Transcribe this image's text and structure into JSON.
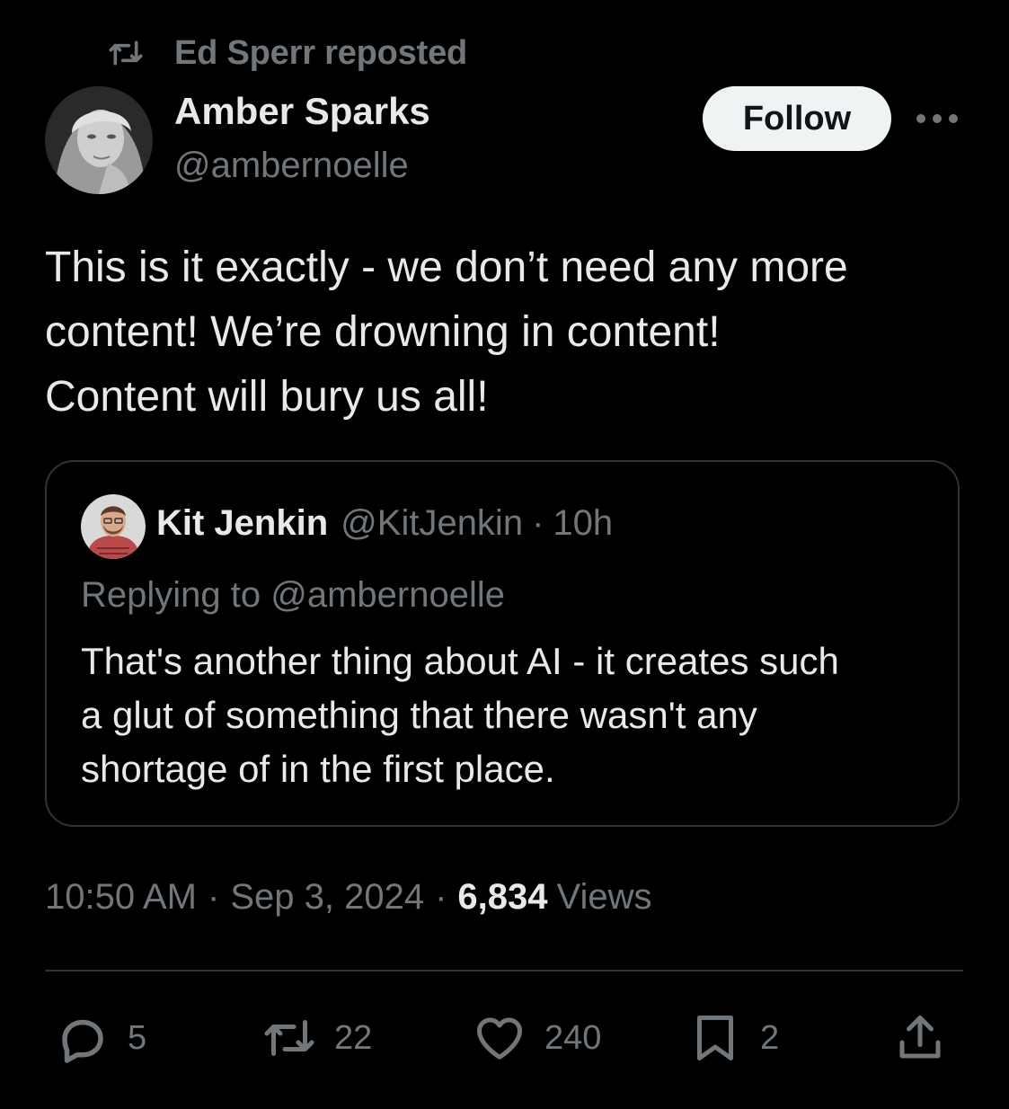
{
  "repost_banner": {
    "text": "Ed Sperr reposted"
  },
  "author": {
    "name": "Amber Sparks",
    "handle": "@ambernoelle"
  },
  "follow_label": "Follow",
  "tweet": {
    "lines": [
      "This is it exactly - we don’t need any more",
      "content! We’re drowning in content!",
      "Content will bury us all!"
    ]
  },
  "quoted": {
    "name": "Kit Jenkin",
    "handle": "@KitJenkin",
    "separator": "·",
    "time": "10h",
    "replying_to": "Replying to @ambernoelle",
    "lines": [
      "That's another thing about AI - it creates such",
      "a glut of something that there wasn't any",
      "shortage of in the first place."
    ]
  },
  "meta": {
    "time": "10:50 AM",
    "sep1": "·",
    "date": "Sep 3, 2024",
    "sep2": "·",
    "views_count": "6,834",
    "views_label": "Views"
  },
  "actions": {
    "replies": "5",
    "reposts": "22",
    "likes": "240",
    "bookmarks": "2"
  },
  "colors": {
    "background": "#000000",
    "text_primary": "#e7e9ea",
    "text_secondary": "#71767b",
    "border": "#2f3336",
    "button_bg": "#eff3f4"
  }
}
